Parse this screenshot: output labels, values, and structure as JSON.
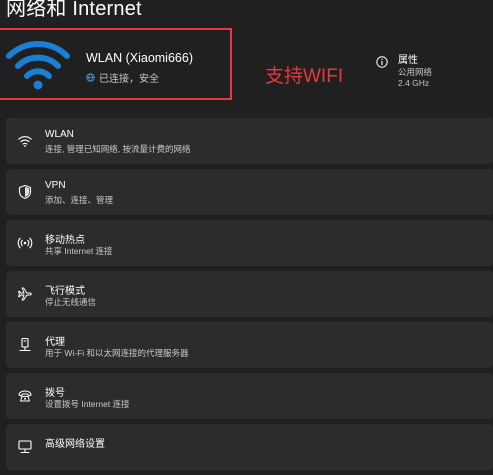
{
  "page": {
    "title": "网络和 Internet"
  },
  "connected_network": {
    "name": "WLAN (Xiaomi666)",
    "status": "已连接，安全",
    "icon": "wifi-icon",
    "accent_color": "#1a7fd6"
  },
  "annotation": {
    "text": "支持WIFI",
    "color": "#e8383d"
  },
  "properties": {
    "title": "属性",
    "line1": "公用网络",
    "line2": "2.4 GHz",
    "icon": "info-icon"
  },
  "settings": [
    {
      "title": "WLAN",
      "desc": "连接, 管理已知网络, 按流量计费的网络",
      "icon": "wifi-icon"
    },
    {
      "title": "VPN",
      "desc": "添加、连接、管理",
      "icon": "shield-icon"
    },
    {
      "title": "移动热点",
      "desc": "共享 Internet 连接",
      "icon": "hotspot-icon"
    },
    {
      "title": "飞行模式",
      "desc": "停止无线通信",
      "icon": "airplane-icon"
    },
    {
      "title": "代理",
      "desc": "用于 Wi-Fi 和以太网连接的代理服务器",
      "icon": "proxy-icon"
    },
    {
      "title": "拨号",
      "desc": "设置拨号 Internet 连接",
      "icon": "dialup-icon"
    },
    {
      "title": "高级网络设置",
      "desc": "",
      "icon": "advanced-network-icon"
    }
  ]
}
